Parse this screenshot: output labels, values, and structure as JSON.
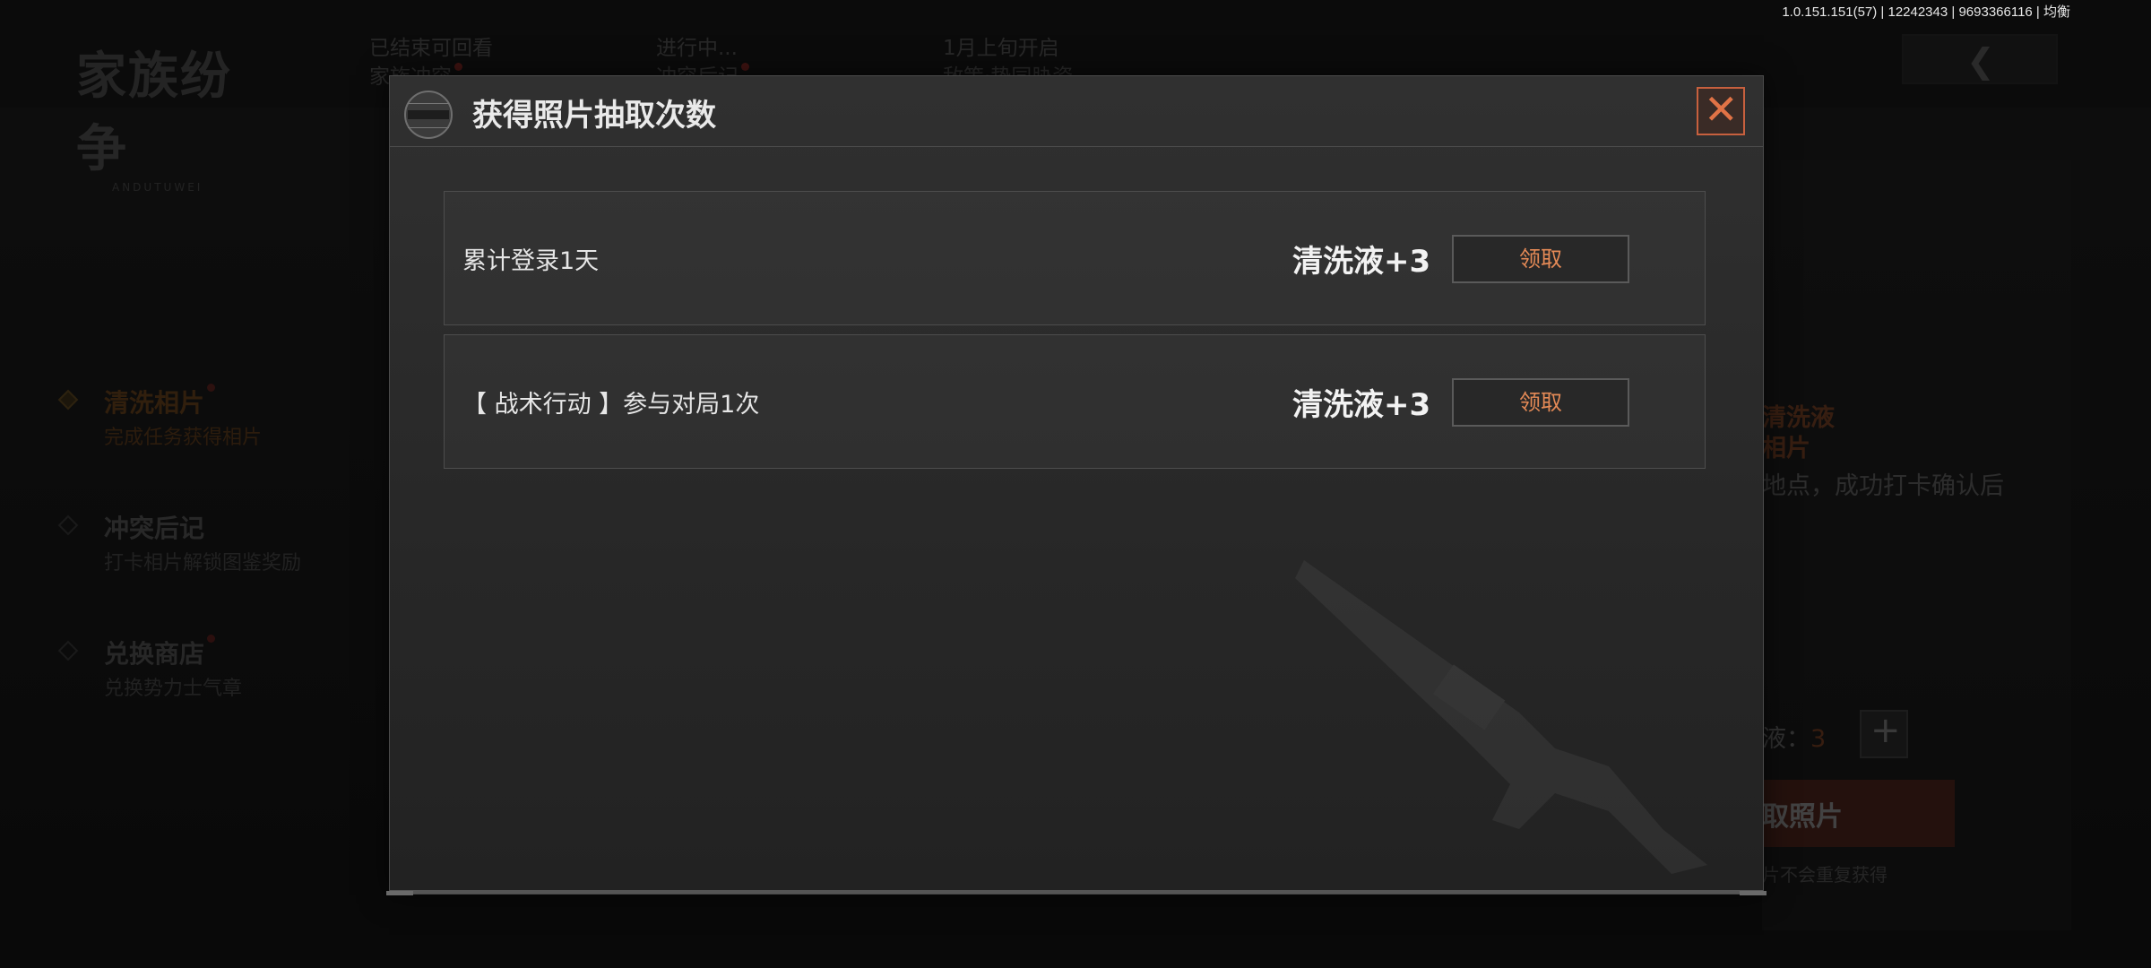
{
  "version": "1.0.151.151(57) | 12242343 | 9693366116 | 均衡",
  "logo": {
    "title": "家族纷争",
    "subtitle": "ANDUTUWEI"
  },
  "tabs": [
    {
      "line1": "已结束可回看",
      "line2": "家族冲突"
    },
    {
      "line1": "进行中...",
      "line2": "冲突后记"
    },
    {
      "line1": "1月上旬开启",
      "line2": "敌策·势同胁瓷"
    }
  ],
  "sidebar": {
    "items": [
      {
        "title": "清洗相片",
        "sub": "完成任务获得相片",
        "active": true
      },
      {
        "title": "冲突后记",
        "sub": "打卡相片解锁图鉴奖励",
        "active": false
      },
      {
        "title": "兑换商店",
        "sub": "兑换势力士气章",
        "active": false
      }
    ]
  },
  "right_panel": {
    "line1": "清洗液",
    "line2": "相片",
    "line3": "地点，成功打卡确认后",
    "count_label": "液：",
    "count_value": "3",
    "draw_button": "取照片",
    "note": "片不会重复获得"
  },
  "modal": {
    "title": "获得照片抽取次数",
    "tasks": [
      {
        "name": "累计登录1天",
        "reward": "清洗液+3",
        "button": "领取"
      },
      {
        "name": "【 战术行动 】参与对局1次",
        "reward": "清洗液+3",
        "button": "领取"
      }
    ]
  },
  "colors": {
    "accent_orange": "#e58a56",
    "close_orange": "#e07346",
    "badge_red": "#c2302a"
  }
}
